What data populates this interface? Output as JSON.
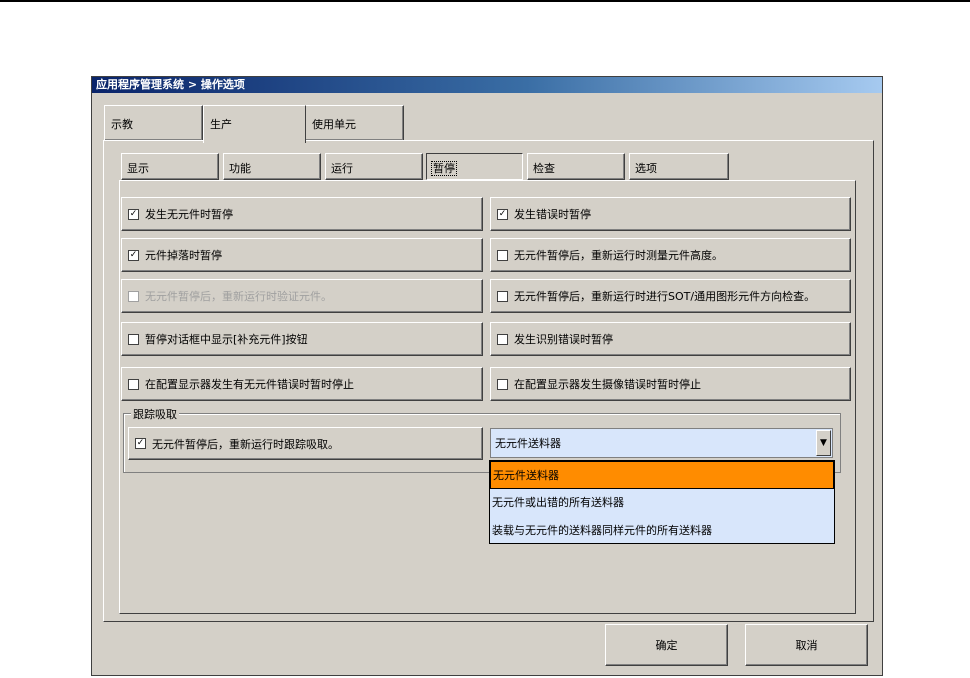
{
  "window": {
    "title": "应用程序管理系统 > 操作选项"
  },
  "top_tabs": [
    {
      "label": "示教",
      "active": false
    },
    {
      "label": "生产",
      "active": true
    },
    {
      "label": "使用单元",
      "active": false
    }
  ],
  "sub_tabs": [
    {
      "label": "显示",
      "active": false
    },
    {
      "label": "功能",
      "active": false
    },
    {
      "label": "运行",
      "active": false
    },
    {
      "label": "暂停",
      "active": true
    },
    {
      "label": "检查",
      "active": false
    },
    {
      "label": "选项",
      "active": false
    }
  ],
  "left_options": [
    {
      "label": "发生无元件时暂停",
      "checked": true,
      "enabled": true
    },
    {
      "label": "元件掉落时暂停",
      "checked": true,
      "enabled": true
    },
    {
      "label": "无元件暂停后，重新运行时验证元件。",
      "checked": false,
      "enabled": false
    },
    {
      "label": "暂停对话框中显示[补充元件]按钮",
      "checked": false,
      "enabled": true
    },
    {
      "label": "在配置显示器发生有无元件错误时暂时停止",
      "checked": false,
      "enabled": true
    }
  ],
  "right_options": [
    {
      "label": "发生错误时暂停",
      "checked": true,
      "enabled": true
    },
    {
      "label": "无元件暂停后，重新运行时测量元件高度。",
      "checked": false,
      "enabled": true
    },
    {
      "label": "无元件暂停后，重新运行时进行SOT/通用图形元件方向检查。",
      "checked": false,
      "enabled": true
    },
    {
      "label": "发生识别错误时暂停",
      "checked": false,
      "enabled": true
    },
    {
      "label": "在配置显示器发生摄像错误时暂时停止",
      "checked": false,
      "enabled": true
    }
  ],
  "tracking_group": {
    "title": "跟踪吸取",
    "checkbox_label": "无元件暂停后，重新运行时跟踪吸取。",
    "checkbox_checked": true,
    "combo_value": "无元件送料器",
    "options": [
      "无元件送料器",
      "无元件或出错的所有送料器",
      "装载与无元件的送料器同样元件的所有送料器"
    ],
    "selected_index": 0
  },
  "buttons": {
    "ok": "确定",
    "cancel": "取消"
  },
  "check_mark": "✓",
  "colors": {
    "title_start": "#0a246a",
    "title_end": "#a6caf0",
    "selection": "#ff8c00",
    "combo_bg": "#d8e6fb",
    "face": "#d4d0c8"
  }
}
